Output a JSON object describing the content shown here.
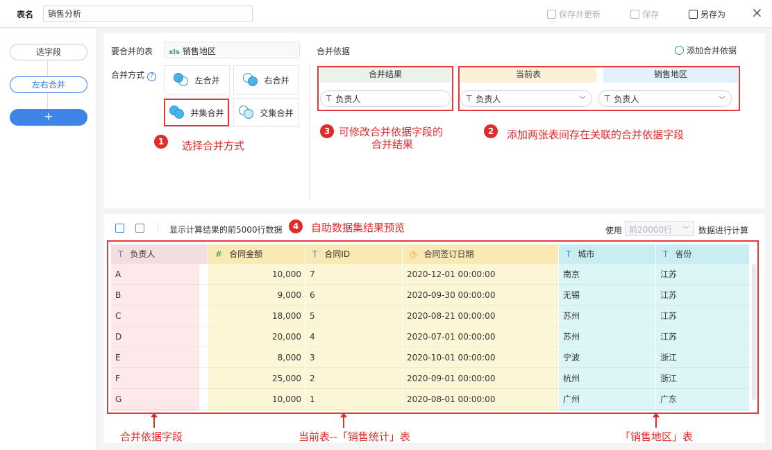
{
  "topbar": {
    "name_label": "表名",
    "name_value": "销售分析",
    "save_update": "保存并更新",
    "save": "保存",
    "save_as": "另存为",
    "close": "×"
  },
  "leftrail": {
    "select_fields": "选字段",
    "lr_merge": "左右合并",
    "add": "+"
  },
  "config": {
    "table_label": "要合并的表",
    "table_xls": "xls",
    "table_value": "销售地区",
    "method_label": "合并方式",
    "help": "?",
    "left_join": "左合并",
    "right_join": "右合并",
    "union_join": "并集合并",
    "inter_join": "交集合并",
    "basis_label": "合并依据",
    "add_basis": "添加合并依据",
    "result_head": "合并结果",
    "current_head": "当前表",
    "region_head": "销售地区",
    "result_field": "负责人",
    "current_field": "负责人",
    "region_field": "负责人",
    "type_t": "T"
  },
  "annotations": {
    "b1": "1",
    "a1": "选择合并方式",
    "b2": "2",
    "a2": "添加两张表间存在关联的合并依据字段",
    "b3": "3",
    "a3_line1": "可修改合并依据字段的",
    "a3_line2": "合并结果",
    "b4": "4",
    "a4": "自助数据集结果预览",
    "bottom1": "合并依据字段",
    "bottom2": "当前表--「销售统计」表",
    "bottom3": "「销售地区」表"
  },
  "preview": {
    "show_text": "显示计算结果的前5000行数据",
    "use_label": "使用",
    "rows_value": "前20000行",
    "calc_label": "数据进行计算"
  },
  "table": {
    "columns": [
      {
        "type": "T",
        "name": "负责人"
      },
      {
        "type": "#",
        "name": "合同金额"
      },
      {
        "type": "T",
        "name": "合同ID"
      },
      {
        "type": "◷",
        "name": "合同签订日期"
      },
      {
        "type": "T",
        "name": "城市"
      },
      {
        "type": "T",
        "name": "省份"
      }
    ],
    "rows": [
      [
        "A",
        "10,000",
        "7",
        "2020-12-01 00:00:00",
        "南京",
        "江苏"
      ],
      [
        "B",
        "9,000",
        "6",
        "2020-09-30 00:00:00",
        "无锡",
        "江苏"
      ],
      [
        "C",
        "18,000",
        "5",
        "2020-08-21 00:00:00",
        "苏州",
        "江苏"
      ],
      [
        "D",
        "20,000",
        "4",
        "2020-07-01 00:00:00",
        "苏州",
        "江苏"
      ],
      [
        "E",
        "8,000",
        "3",
        "2020-10-01 00:00:00",
        "宁波",
        "浙江"
      ],
      [
        "F",
        "25,000",
        "2",
        "2020-09-01 00:00:00",
        "杭州",
        "浙江"
      ],
      [
        "G",
        "10,000",
        "1",
        "2020-08-01 00:00:00",
        "广州",
        "广东"
      ]
    ]
  },
  "colors": {
    "accent": "#3d86e8",
    "annotation_red": "#e02b2b",
    "col_pink": "#fde8ea",
    "col_yellow": "#fdf6d6",
    "col_cyan": "#dcf5f7"
  }
}
